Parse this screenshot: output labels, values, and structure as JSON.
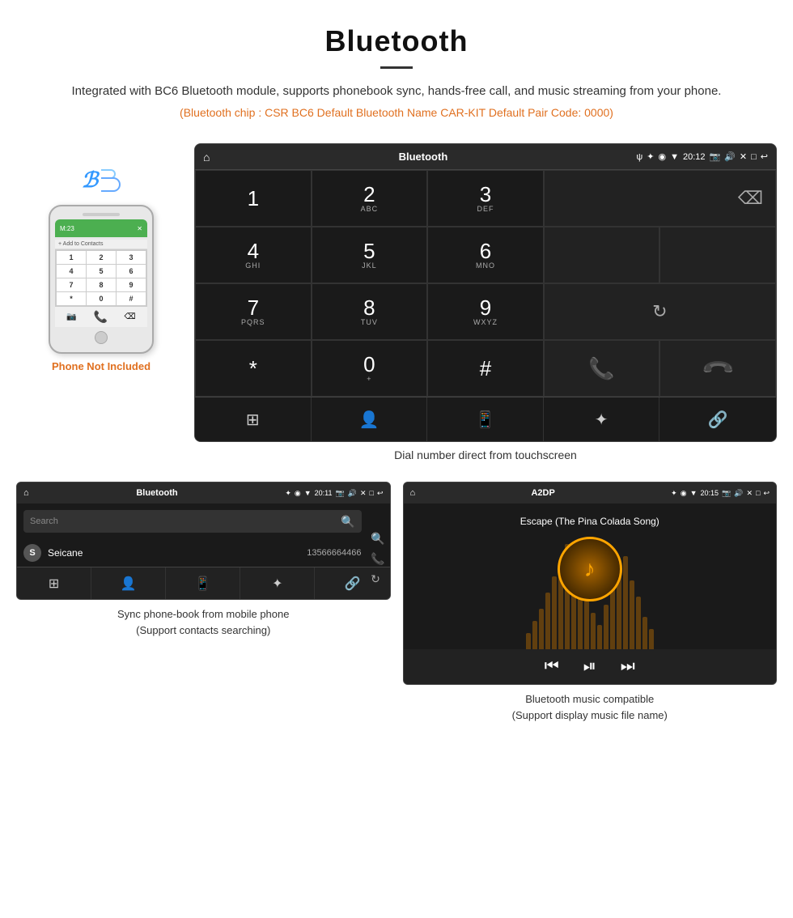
{
  "header": {
    "title": "Bluetooth",
    "description": "Integrated with BC6 Bluetooth module, supports phonebook sync, hands-free call, and music streaming from your phone.",
    "specs": "(Bluetooth chip : CSR BC6   Default Bluetooth Name CAR-KIT    Default Pair Code: 0000)"
  },
  "phone": {
    "not_included_label": "Phone Not Included"
  },
  "dial_screen": {
    "title": "Bluetooth",
    "time": "20:12",
    "keys": [
      {
        "num": "1",
        "sub": ""
      },
      {
        "num": "2",
        "sub": "ABC"
      },
      {
        "num": "3",
        "sub": "DEF"
      },
      {
        "num": "4",
        "sub": "GHI"
      },
      {
        "num": "5",
        "sub": "JKL"
      },
      {
        "num": "6",
        "sub": "MNO"
      },
      {
        "num": "7",
        "sub": "PQRS"
      },
      {
        "num": "8",
        "sub": "TUV"
      },
      {
        "num": "9",
        "sub": "WXYZ"
      },
      {
        "num": "*",
        "sub": ""
      },
      {
        "num": "0",
        "sub": "+"
      },
      {
        "num": "#",
        "sub": ""
      }
    ],
    "caption": "Dial number direct from touchscreen"
  },
  "contacts_screen": {
    "title": "Bluetooth",
    "time": "20:11",
    "search_placeholder": "Search",
    "contact": {
      "letter": "S",
      "name": "Seicane",
      "number": "13566664466"
    },
    "caption_line1": "Sync phone-book from mobile phone",
    "caption_line2": "(Support contacts searching)"
  },
  "music_screen": {
    "title": "A2DP",
    "time": "20:15",
    "song_name": "Escape (The Pina Colada Song)",
    "caption_line1": "Bluetooth music compatible",
    "caption_line2": "(Support display music file name)"
  },
  "icons": {
    "home": "⌂",
    "usb": "ψ",
    "bluetooth": "⚡",
    "wifi": "▼",
    "gps": "◉",
    "camera": "📷",
    "volume": "🔊",
    "close": "✕",
    "window": "□",
    "back": "↩",
    "backspace": "⌫",
    "refresh": "↻",
    "call_green": "📞",
    "call_red": "📵",
    "keypad": "⊞",
    "person": "👤",
    "phone": "📱",
    "bt": "✦",
    "link": "🔗",
    "prev": "⏮",
    "play": "⏯",
    "next": "⏭"
  }
}
